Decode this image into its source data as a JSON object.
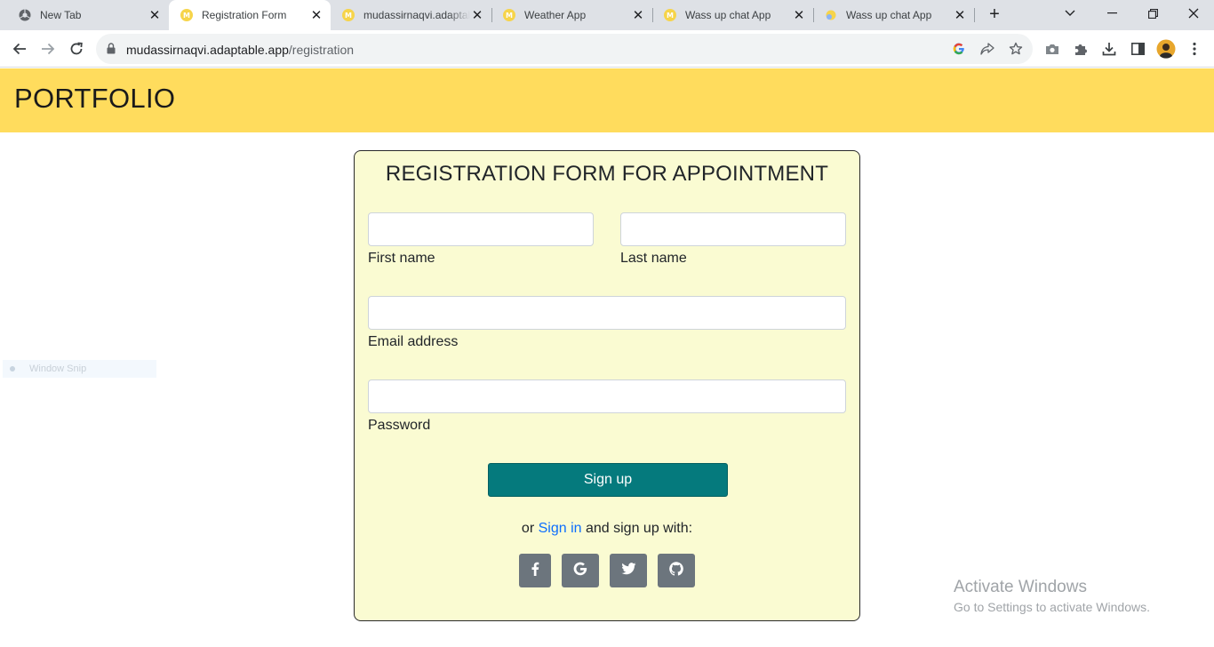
{
  "browser": {
    "tabs": [
      {
        "title": "New Tab",
        "icon": "chrome-icon"
      },
      {
        "title": "Registration Form",
        "icon": "m-favicon",
        "active": true
      },
      {
        "title": "mudassirnaqvi.adaptable.app",
        "icon": "m-favicon"
      },
      {
        "title": "Weather App",
        "icon": "m-favicon"
      },
      {
        "title": "Wass up chat App",
        "icon": "m-favicon"
      },
      {
        "title": "Wass up chat App",
        "icon": "chat-favicon"
      }
    ],
    "favicon_letter": "M",
    "address": {
      "domain": "mudassirnaqvi.adaptable.app",
      "path": "/registration"
    },
    "accent_favicon_color": "#f6d44a"
  },
  "site": {
    "brand": "PORTFOLIO",
    "header_color": "#ffdc5d"
  },
  "form": {
    "title": "REGISTRATION FORM FOR APPOINTMENT",
    "first_name": {
      "label": "First name",
      "value": ""
    },
    "last_name": {
      "label": "Last name",
      "value": ""
    },
    "email": {
      "label": "Email address",
      "value": ""
    },
    "password": {
      "label": "Password",
      "value": ""
    },
    "submit_label": "Sign up",
    "alt_prefix": "or",
    "alt_link": "Sign in",
    "alt_suffix": "and sign up with:",
    "social": [
      "facebook-icon",
      "google-icon",
      "twitter-icon",
      "github-icon"
    ],
    "card_color": "#fafbd2",
    "button_color": "#057a7d"
  },
  "overlays": {
    "snip_label": "Window Snip",
    "activate_title": "Activate Windows",
    "activate_subtitle": "Go to Settings to activate Windows."
  }
}
